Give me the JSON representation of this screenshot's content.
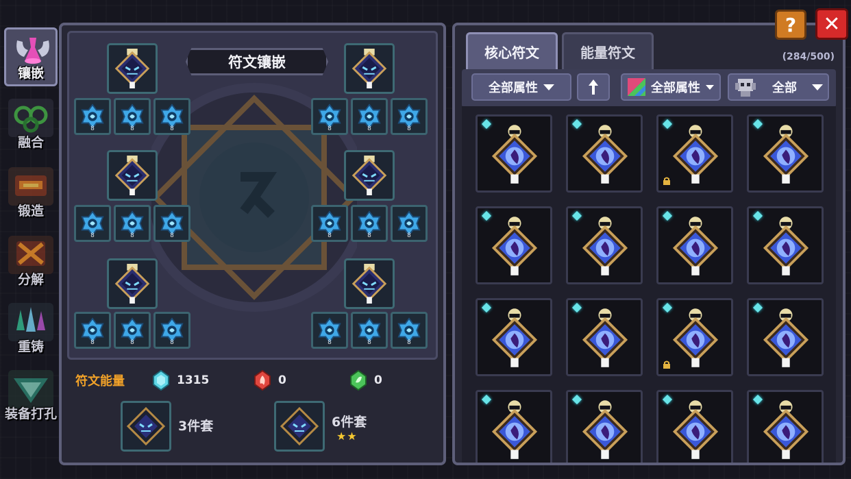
{
  "side_tabs": [
    {
      "label": "镶嵌",
      "active": true,
      "icon": "inlay-icon"
    },
    {
      "label": "融合",
      "active": false,
      "icon": "fusion-icon"
    },
    {
      "label": "锻造",
      "active": false,
      "icon": "forge-icon"
    },
    {
      "label": "分解",
      "active": false,
      "icon": "decompose-icon"
    },
    {
      "label": "重铸",
      "active": false,
      "icon": "recast-icon"
    },
    {
      "label": "装备打孔",
      "active": false,
      "icon": "socket-punch-icon"
    }
  ],
  "left": {
    "title": "符文镶嵌",
    "small_slot_level": "8",
    "energy_label": "符文能量",
    "energy": [
      {
        "icon": "cyan-energy-icon",
        "value": "1315",
        "color": "#5fd6e6"
      },
      {
        "icon": "red-energy-icon",
        "value": "0",
        "color": "#e0473f"
      },
      {
        "icon": "green-energy-icon",
        "value": "0",
        "color": "#4cc45a"
      }
    ],
    "sets": [
      {
        "label": "3件套",
        "stars": ""
      },
      {
        "label": "6件套",
        "stars": "★★"
      }
    ]
  },
  "right": {
    "tabs": [
      "核心符文",
      "能量符文"
    ],
    "count": "(284/500)",
    "filters": {
      "attr1": "全部属性",
      "attr2": "全部属性",
      "monster": "全部"
    },
    "grid": {
      "locked_cells": [
        2,
        10
      ]
    }
  },
  "buttons": {
    "help": "?",
    "close": "✕"
  },
  "colors": {
    "accent_cyan": "#5fd6e6",
    "orange": "#f2a228",
    "close_red": "#d62a2a",
    "help_orange": "#d07b23"
  }
}
